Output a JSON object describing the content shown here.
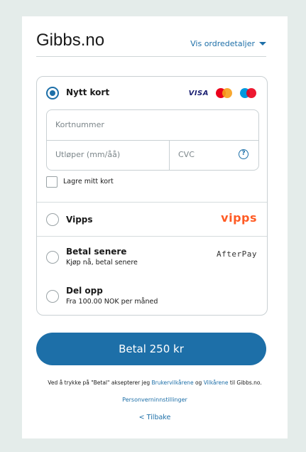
{
  "header": {
    "title": "Gibbs.no",
    "details_toggle": "Vis ordredetaljer"
  },
  "methods": {
    "card": {
      "title": "Nytt kort",
      "selected": true,
      "logos": [
        "VISA",
        "mastercard-icon",
        "maestro-icon"
      ],
      "visa_label": "VISA",
      "number_placeholder": "Kortnummer",
      "expiry_placeholder": "Utløper (mm/åå)",
      "cvc_placeholder": "CVC",
      "help_symbol": "?",
      "save_card_label": "Lagre mitt kort"
    },
    "vipps": {
      "title": "Vipps",
      "logo": "vipps"
    },
    "pay_later": {
      "title": "Betal senere",
      "subtitle": "Kjøp nå, betal senere",
      "logo": "AfterPay"
    },
    "split": {
      "title": "Del opp",
      "subtitle": "Fra 100.00 NOK per måned"
    }
  },
  "pay_button": "Betal 250 kr",
  "legal": {
    "prefix": "Ved å trykke på \"Betal\" aksepterer jeg ",
    "link1": "Brukervilkårene",
    "middle": " og ",
    "link2": "Vilkårene",
    "suffix": " til Gibbs.no."
  },
  "privacy_link": "Personverninnstillinger",
  "back_link": "< Tilbake",
  "colors": {
    "accent": "#1d6fa8",
    "vipps": "#ff5b24",
    "background": "#e4ecea"
  }
}
